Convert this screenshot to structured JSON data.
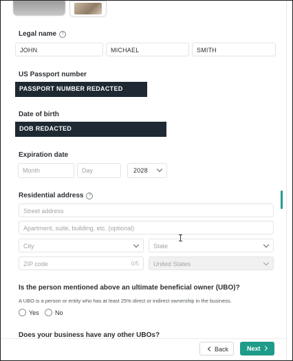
{
  "legal_name": {
    "label": "Legal name",
    "first": "JOHN",
    "middle": "MICHAEL",
    "last": "SMITH"
  },
  "passport": {
    "label": "US Passport number",
    "value": "PASSPORT NUMBER REDACTED"
  },
  "dob": {
    "label": "Date of birth",
    "value": "DOB REDACTED"
  },
  "expiration": {
    "label": "Expiration date",
    "month_placeholder": "Month",
    "day_placeholder": "Day",
    "year_value": "2028"
  },
  "address": {
    "label": "Residential address",
    "street_placeholder": "Street address",
    "apt_placeholder": "Apartment, suite, building, etc. (optional)",
    "city_placeholder": "City",
    "state_placeholder": "State",
    "zip_placeholder": "ZIP code",
    "zip_counter": "0/5",
    "country_value": "United States"
  },
  "ubo": {
    "question": "Is the person mentioned above an ultimate beneficial owner (UBO)?",
    "hint": "A UBO is a person or entity who has at least 25% direct or indirect ownership in the business.",
    "yes_label": "Yes",
    "no_label": "No",
    "next_question": "Does your business have any other UBOs?"
  },
  "footer": {
    "back_label": "Back",
    "next_label": "Next"
  },
  "colors": {
    "accent": "#1f9b8a",
    "redaction": "#1f2933"
  }
}
